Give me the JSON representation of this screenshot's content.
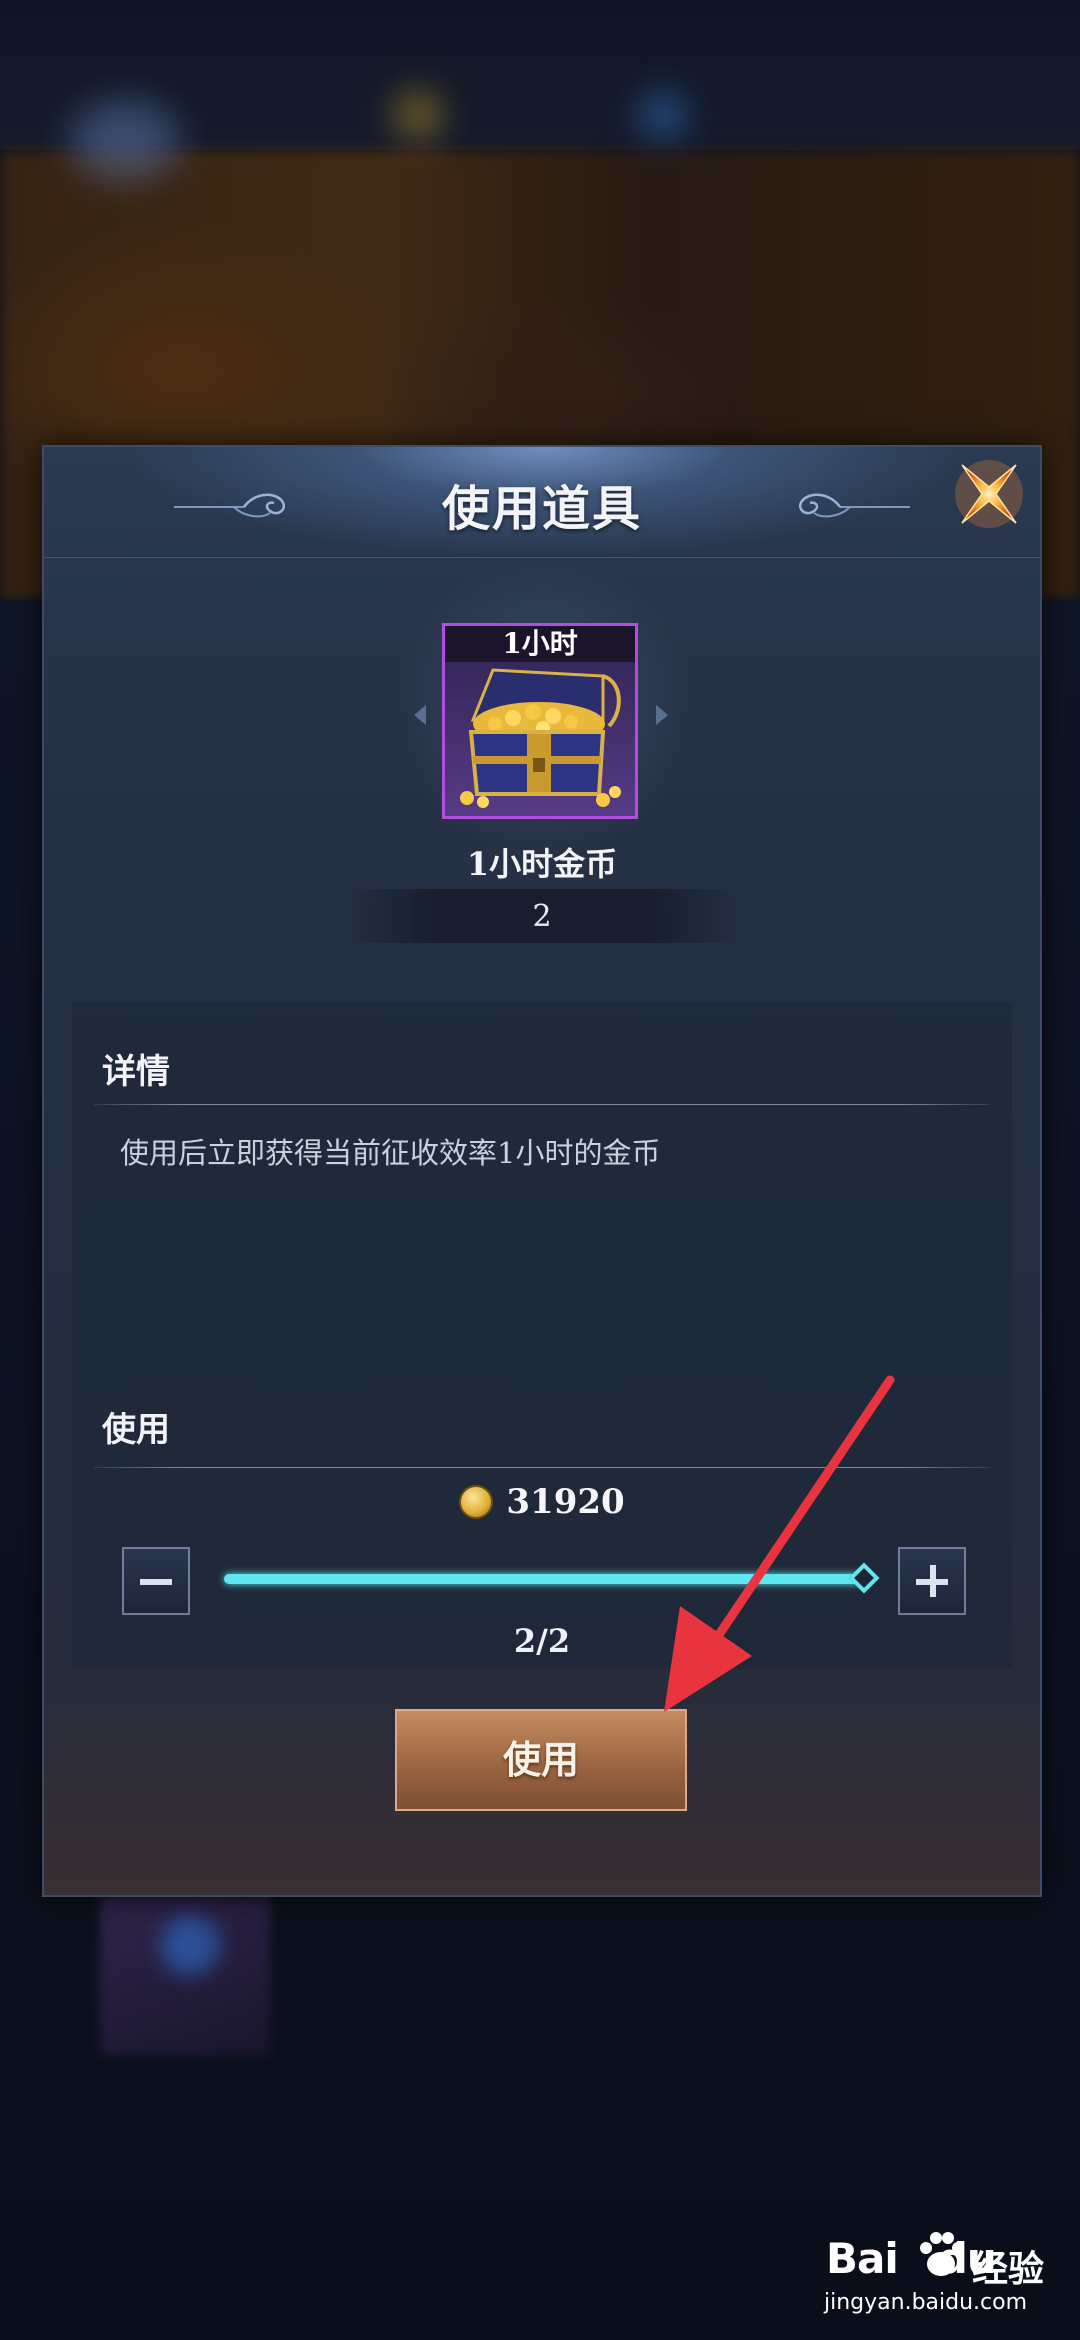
{
  "dialog": {
    "title": "使用道具",
    "close_icon": "close-x-icon",
    "accent_color": "#5fe7f0",
    "rarity_color": "#b14ee0"
  },
  "item": {
    "duration_badge": "1小时",
    "icon": "gold-chest-icon",
    "name": "1小时金币",
    "owned_count": "2"
  },
  "detail": {
    "heading": "详情",
    "description": "使用后立即获得当前征收效率1小时的金币"
  },
  "usage": {
    "heading": "使用",
    "coin_icon": "gold-coin-icon",
    "coin_amount": "31920",
    "quantity_label": "2/2",
    "quantity_selected": 2,
    "quantity_max": 2
  },
  "action": {
    "use_label": "使用"
  },
  "watermark": {
    "brand_latin_a": "Bai",
    "brand_latin_b": "du",
    "brand_cn": "经验",
    "url": "jingyan.baidu.com"
  }
}
